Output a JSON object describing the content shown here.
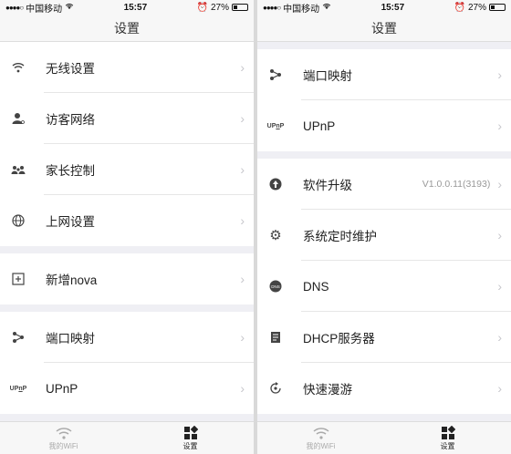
{
  "status_bar": {
    "carrier": "中国移动",
    "time": "15:57",
    "battery": "27%"
  },
  "left": {
    "title": "设置",
    "items": [
      {
        "icon": "wifi-icon",
        "label": "无线设置"
      },
      {
        "icon": "guest-user-icon",
        "label": "访客网络"
      },
      {
        "icon": "family-icon",
        "label": "家长控制"
      },
      {
        "icon": "globe-icon",
        "label": "上网设置"
      },
      {
        "icon": "add-box-icon",
        "label": "新增nova"
      },
      {
        "icon": "port-map-icon",
        "label": "端口映射"
      },
      {
        "icon": "upnp-icon",
        "label": "UPnP"
      }
    ]
  },
  "right": {
    "title": "设置",
    "items": [
      {
        "icon": "port-map-icon",
        "label": "端口映射"
      },
      {
        "icon": "upnp-icon",
        "label": "UPnP"
      },
      {
        "icon": "upgrade-icon",
        "label": "软件升级",
        "value": "V1.0.0.11(3193)"
      },
      {
        "icon": "gear-icon",
        "label": "系统定时维护"
      },
      {
        "icon": "dns-icon",
        "label": "DNS"
      },
      {
        "icon": "dhcp-icon",
        "label": "DHCP服务器"
      },
      {
        "icon": "roaming-icon",
        "label": "快速漫游"
      }
    ]
  },
  "tabbar": {
    "tab1": "我的WiFi",
    "tab2": "设置"
  }
}
